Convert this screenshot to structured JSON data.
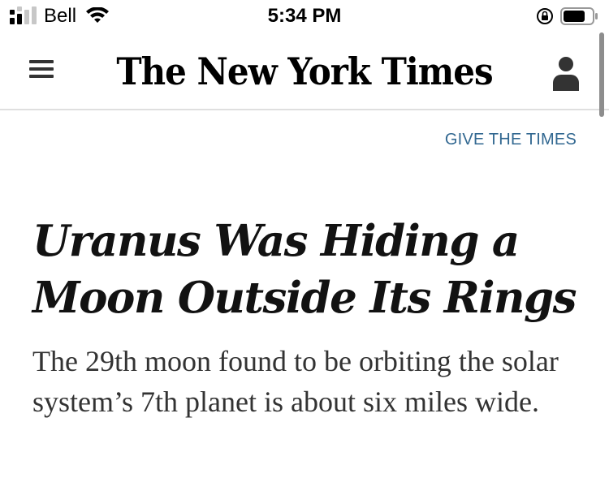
{
  "status_bar": {
    "carrier": "Bell",
    "time": "5:34 PM",
    "icons": [
      "signal-icon",
      "wifi-icon",
      "orientation-lock-icon",
      "battery-icon"
    ]
  },
  "masthead": {
    "logo_text": "The New York Times",
    "icons": [
      "menu-icon",
      "account-icon"
    ]
  },
  "article": {
    "give_link": "GIVE THE TIMES",
    "headline": "Uranus Was Hiding a Moon Outside Its Rings",
    "summary": "The 29th moon found to be orbiting the solar system’s 7th planet is about six miles wide."
  },
  "colors": {
    "link": "#326891",
    "text": "#121212",
    "divider": "#dfdfdf"
  }
}
